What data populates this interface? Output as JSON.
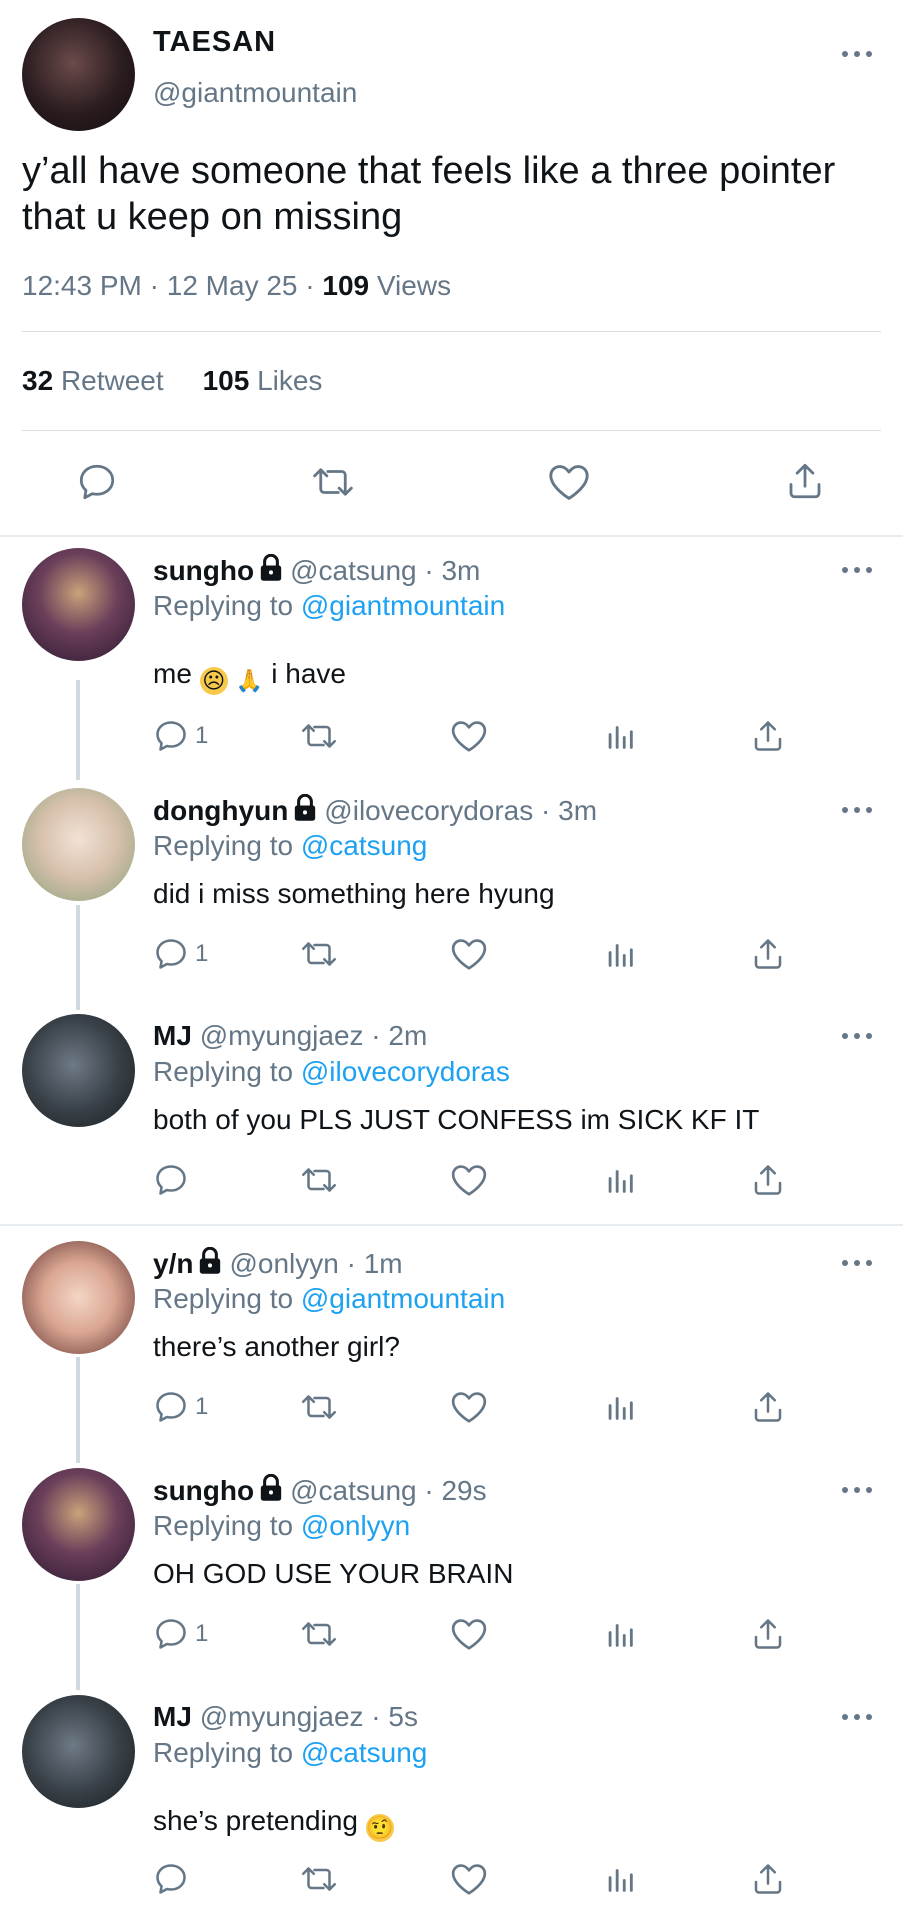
{
  "main_tweet": {
    "name": "TAESAN",
    "handle": "@giantmountain",
    "text": "y’all have someone that feels like a three pointer that u keep on missing",
    "time": "12:43 PM",
    "date": "12 May 25",
    "views_count": "109",
    "views_label": "Views",
    "retweets_count": "32",
    "retweets_label": "Retweet",
    "likes_count": "105",
    "likes_label": "Likes"
  },
  "icons": {
    "reply": "reply-icon",
    "retweet": "retweet-icon",
    "like": "heart-icon",
    "share": "share-icon",
    "analytics": "analytics-icon",
    "more": "more-icon",
    "lock": "lock-icon"
  },
  "colors": {
    "link": "#1da1f2",
    "muted": "#657786",
    "text": "#0f1419"
  },
  "replying_label": "Replying to",
  "replies": [
    {
      "name": "sungho",
      "locked": true,
      "handle": "@catsung",
      "time": "3m",
      "replying_to": "@giantmountain",
      "text": "me",
      "text_suffix": "i have",
      "emoji": [
        "disappointed",
        "folded-hands"
      ],
      "reply_count": "1"
    },
    {
      "name": "donghyun",
      "locked": true,
      "handle": "@ilovecorydoras",
      "time": "3m",
      "replying_to": "@catsung",
      "text": "did i miss something here hyung",
      "reply_count": "1"
    },
    {
      "name": "MJ",
      "locked": false,
      "handle": "@myungjaez",
      "time": "2m",
      "replying_to": "@ilovecorydoras",
      "text": "both of you PLS JUST CONFESS im SICK KF IT",
      "reply_count": ""
    },
    {
      "name": "y/n",
      "locked": true,
      "handle": "@onlyyn",
      "time": "1m",
      "replying_to": "@giantmountain",
      "text": "there’s another girl?",
      "reply_count": "1"
    },
    {
      "name": "sungho",
      "locked": true,
      "handle": "@catsung",
      "time": "29s",
      "replying_to": "@onlyyn",
      "text": "OH GOD USE YOUR BRAIN",
      "reply_count": "1"
    },
    {
      "name": "MJ",
      "locked": false,
      "handle": "@myungjaez",
      "time": "5s",
      "replying_to": "@catsung",
      "text": "she’s pretending",
      "emoji": [
        "raised-eyebrow"
      ],
      "reply_count": ""
    }
  ]
}
